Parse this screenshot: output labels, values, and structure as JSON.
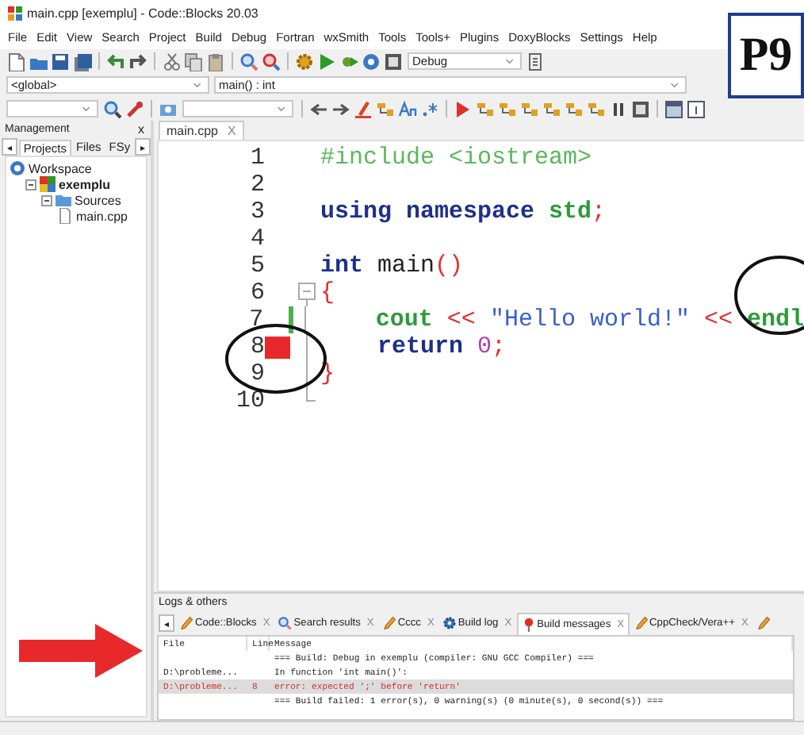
{
  "window": {
    "title": "main.cpp [exemplu] - Code::Blocks 20.03"
  },
  "menu": [
    "File",
    "Edit",
    "View",
    "Search",
    "Project",
    "Build",
    "Debug",
    "Fortran",
    "wxSmith",
    "Tools",
    "Tools+",
    "Plugins",
    "DoxyBlocks",
    "Settings",
    "Help"
  ],
  "toolbar": {
    "build_target": "Debug",
    "scope": "<global>",
    "function": "main() : int"
  },
  "badge": "P9",
  "management": {
    "title": "Management",
    "close": "x",
    "scroll_left": "◂",
    "scroll_right": "▸",
    "tabs": [
      {
        "label": "Projects",
        "selected": true
      },
      {
        "label": "Files",
        "selected": false
      },
      {
        "label": "FSy",
        "selected": false
      }
    ],
    "tree": [
      {
        "label": "Workspace",
        "kind": "workspace",
        "children": [
          {
            "label": "exemplu",
            "kind": "project",
            "expanded": true,
            "children": [
              {
                "label": "Sources",
                "kind": "folder",
                "expanded": true,
                "children": [
                  {
                    "label": "main.cpp",
                    "kind": "file"
                  }
                ]
              }
            ]
          }
        ]
      }
    ]
  },
  "editor": {
    "tabs": [
      {
        "label": "main.cpp",
        "close": "X",
        "selected": true
      }
    ],
    "lines": [
      {
        "number": "1",
        "segments": [
          {
            "text": "#include <iostream>",
            "kind": "preprocessor"
          }
        ]
      },
      {
        "number": "2"
      },
      {
        "number": "3",
        "segments": [
          {
            "text": "using namespace ",
            "kind": "keyword"
          },
          {
            "text": "std",
            "kind": "identifier"
          },
          {
            "text": ";",
            "kind": "operator"
          }
        ]
      },
      {
        "number": "4"
      },
      {
        "number": "5",
        "segments": [
          {
            "text": "int ",
            "kind": "keyword"
          },
          {
            "text": "main",
            "kind": "plain"
          },
          {
            "text": "()",
            "kind": "operator"
          }
        ]
      },
      {
        "number": "6",
        "fold_expanded": true,
        "segments": [
          {
            "text": "{",
            "kind": "operator"
          }
        ]
      },
      {
        "number": "7",
        "in_fold": true,
        "changed": true,
        "indented": true,
        "segments": [
          {
            "text": "cout ",
            "kind": "identifier"
          },
          {
            "text": "<< ",
            "kind": "operator"
          },
          {
            "text": "\"Hello world!\" ",
            "kind": "string"
          },
          {
            "text": "<< ",
            "kind": "operator"
          },
          {
            "text": "endl",
            "kind": "identifier"
          }
        ]
      },
      {
        "number": "8",
        "in_fold": true,
        "error": true,
        "indented": true,
        "segments": [
          {
            "text": "return ",
            "kind": "keyword"
          },
          {
            "text": "0",
            "kind": "number"
          },
          {
            "text": ";",
            "kind": "operator"
          }
        ]
      },
      {
        "number": "9",
        "in_fold": true,
        "segments": [
          {
            "text": "}",
            "kind": "operator"
          }
        ]
      },
      {
        "number": "10",
        "fold_end": true
      }
    ]
  },
  "logs": {
    "title": "Logs & others",
    "scroll_left": "◂",
    "tabs": [
      {
        "label": "Code::Blocks",
        "kind": "pencil",
        "close": "X",
        "selected": false
      },
      {
        "label": "Search results",
        "kind": "search",
        "close": "X",
        "selected": false
      },
      {
        "label": "Cccc",
        "kind": "pencil",
        "close": "X",
        "selected": false
      },
      {
        "label": "Build log",
        "kind": "gear",
        "close": "X",
        "selected": false
      },
      {
        "label": "Build messages",
        "kind": "pin",
        "close": "X",
        "selected": true
      },
      {
        "label": "CppCheck/Vera++",
        "kind": "pencil",
        "close": "X",
        "selected": false
      },
      {
        "kind": "pencil",
        "selected": false
      }
    ],
    "columns": [
      "File",
      "Line",
      "Message"
    ],
    "rows": [
      {
        "file": "",
        "line": "",
        "message": "=== Build: Debug in exemplu (compiler: GNU GCC Compiler) ===",
        "error": false,
        "selected": false
      },
      {
        "file": "D:\\probleme...",
        "line": "",
        "message": "In function 'int main()':",
        "error": false,
        "selected": false
      },
      {
        "file": "D:\\probleme...",
        "line": "8",
        "message": "error: expected ';' before 'return'",
        "error": true,
        "selected": true
      },
      {
        "file": "",
        "line": "",
        "message": "=== Build failed: 1 error(s), 0 warning(s) (0 minute(s), 0 second(s)) ===",
        "error": false,
        "selected": false
      }
    ]
  }
}
